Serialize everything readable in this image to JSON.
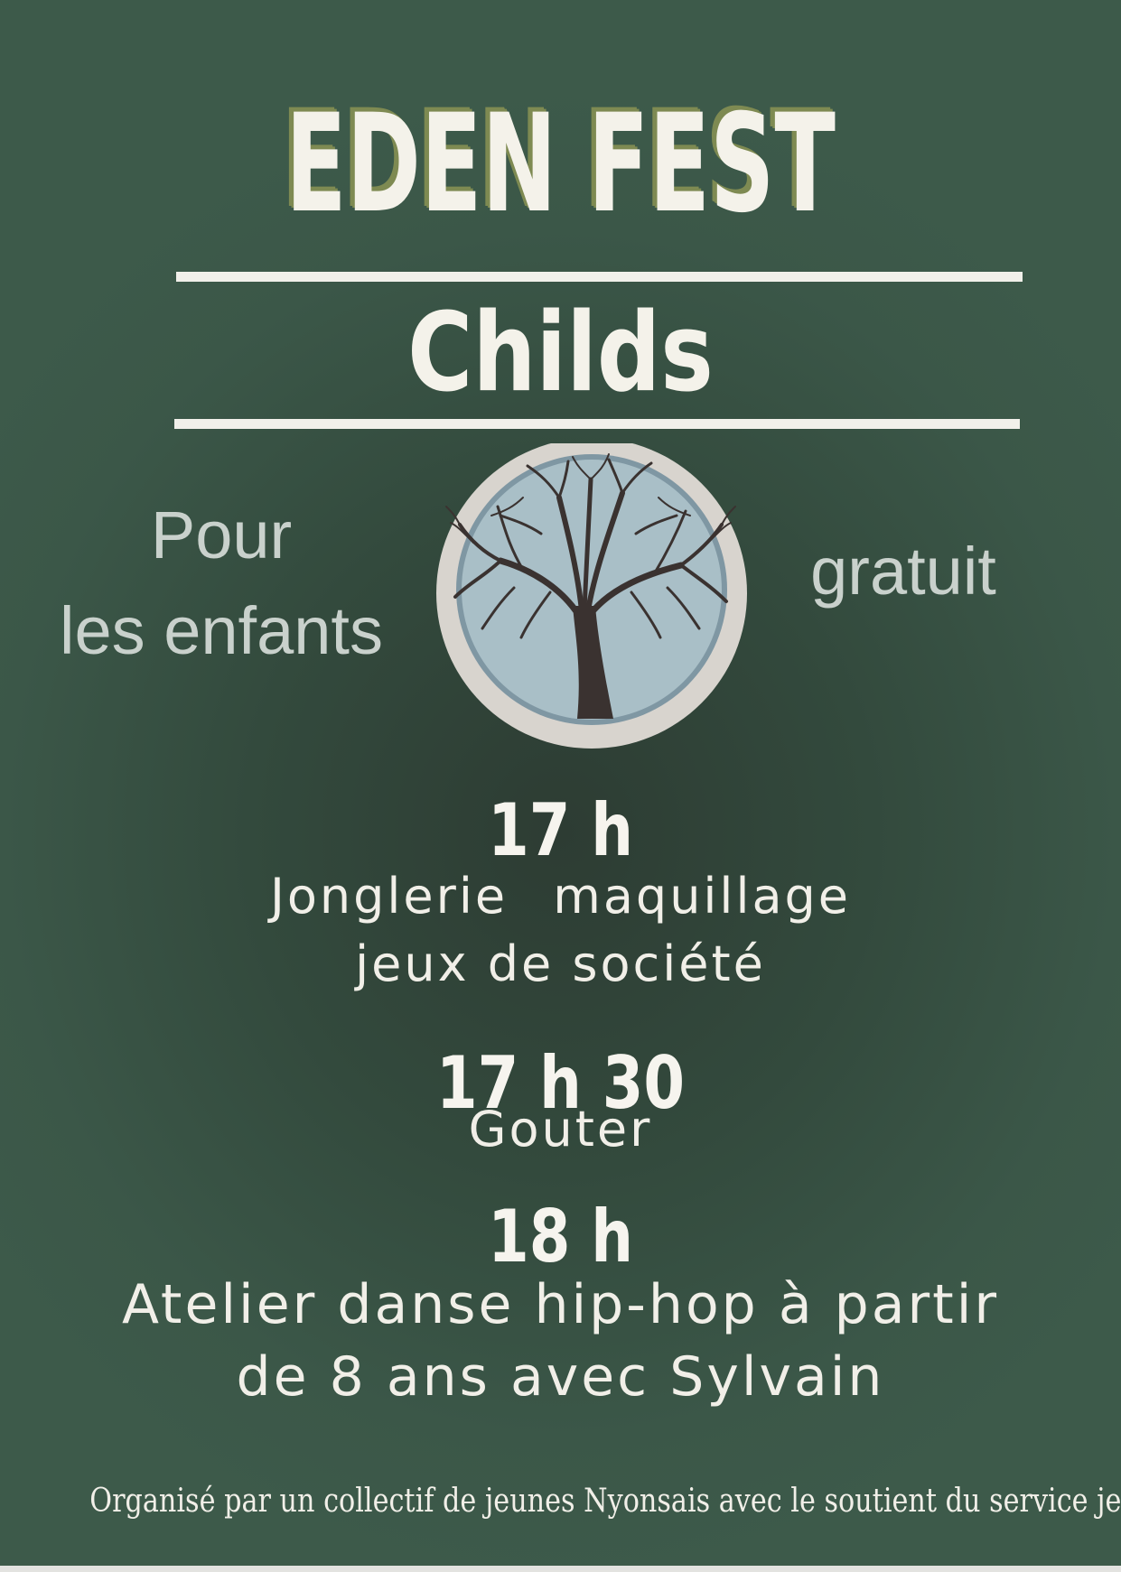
{
  "title": "EDEN FEST",
  "subtitle": "Childs",
  "left_note": {
    "line1": "Pour",
    "line2": "les enfants"
  },
  "right_note": "gratuit",
  "logo": {
    "icon": "tree-icon",
    "ring_color": "#d8d4ce",
    "inner_color": "#a9bfc7",
    "tree_color": "#3a3230"
  },
  "program": [
    {
      "time": "17 h",
      "lines": [
        "Jonglerie   maquillage",
        "jeux de société"
      ]
    },
    {
      "time": "17 h 30",
      "lines": [
        "Gouter"
      ]
    },
    {
      "time": "18 h",
      "lines": [
        "Atelier danse hip-hop à partir",
        "de 8 ans avec Sylvain"
      ]
    }
  ],
  "footer": "Organisé par un collectif de jeunes Nyonsais avec le soutient du service jeunesse",
  "colors": {
    "background": "#3d5a4a",
    "title_shadow": "#7e8a52",
    "text": "#f3f1ea"
  }
}
